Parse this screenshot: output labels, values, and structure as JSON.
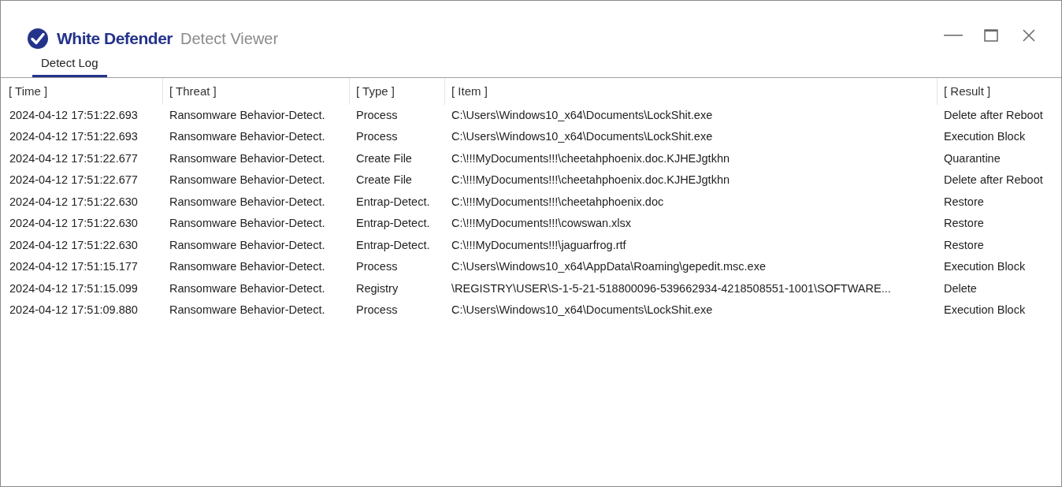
{
  "window": {
    "brand": "White Defender",
    "title": "Detect Viewer"
  },
  "tabs": [
    {
      "label": "Detect Log",
      "selected": true
    }
  ],
  "table": {
    "columns": [
      "[ Time ]",
      "[ Threat ]",
      "[ Type ]",
      "[ Item ]",
      "[ Result ]"
    ],
    "rows": [
      [
        "2024-04-12 17:51:22.693",
        "Ransomware Behavior-Detect.",
        "Process",
        "C:\\Users\\Windows10_x64\\Documents\\LockShit.exe",
        "Delete after Reboot"
      ],
      [
        "2024-04-12 17:51:22.693",
        "Ransomware Behavior-Detect.",
        "Process",
        "C:\\Users\\Windows10_x64\\Documents\\LockShit.exe",
        "Execution Block"
      ],
      [
        "2024-04-12 17:51:22.677",
        "Ransomware Behavior-Detect.",
        "Create File",
        "C:\\!!!MyDocuments!!!\\cheetahphoenix.doc.KJHEJgtkhn",
        "Quarantine"
      ],
      [
        "2024-04-12 17:51:22.677",
        "Ransomware Behavior-Detect.",
        "Create File",
        "C:\\!!!MyDocuments!!!\\cheetahphoenix.doc.KJHEJgtkhn",
        "Delete after Reboot"
      ],
      [
        "2024-04-12 17:51:22.630",
        "Ransomware Behavior-Detect.",
        "Entrap-Detect.",
        "C:\\!!!MyDocuments!!!\\cheetahphoenix.doc",
        "Restore"
      ],
      [
        "2024-04-12 17:51:22.630",
        "Ransomware Behavior-Detect.",
        "Entrap-Detect.",
        "C:\\!!!MyDocuments!!!\\cowswan.xlsx",
        "Restore"
      ],
      [
        "2024-04-12 17:51:22.630",
        "Ransomware Behavior-Detect.",
        "Entrap-Detect.",
        "C:\\!!!MyDocuments!!!\\jaguarfrog.rtf",
        "Restore"
      ],
      [
        "2024-04-12 17:51:15.177",
        "Ransomware Behavior-Detect.",
        "Process",
        "C:\\Users\\Windows10_x64\\AppData\\Roaming\\gepedit.msc.exe",
        "Execution Block"
      ],
      [
        "2024-04-12 17:51:15.099",
        "Ransomware Behavior-Detect.",
        "Registry",
        "\\REGISTRY\\USER\\S-1-5-21-518800096-539662934-4218508551-1001\\SOFTWARE...",
        "Delete"
      ],
      [
        "2024-04-12 17:51:09.880",
        "Ransomware Behavior-Detect.",
        "Process",
        "C:\\Users\\Windows10_x64\\Documents\\LockShit.exe",
        "Execution Block"
      ]
    ]
  }
}
